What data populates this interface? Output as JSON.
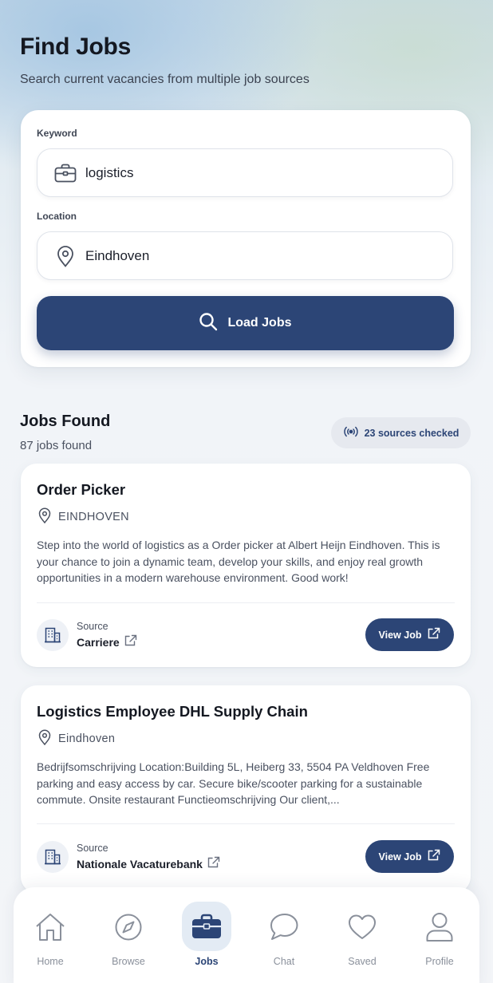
{
  "header": {
    "title": "Find Jobs",
    "subtitle": "Search current vacancies from multiple job sources"
  },
  "search": {
    "keyword_label": "Keyword",
    "keyword_value": "logistics",
    "location_label": "Location",
    "location_value": "Eindhoven",
    "load_button_label": "Load Jobs"
  },
  "results": {
    "heading": "Jobs Found",
    "count_text": "87 jobs found",
    "sources_badge": "23 sources checked"
  },
  "jobs": [
    {
      "title": "Order Picker",
      "location": "EINDHOVEN",
      "description": "Step into the world of logistics as a Order picker at Albert Heijn Eindhoven. This is your chance to join a dynamic team, develop your skills, and enjoy real growth opportunities in a modern warehouse environment. Good work!",
      "source_label": "Source",
      "source_name": "Carriere",
      "view_label": "View Job"
    },
    {
      "title": "Logistics Employee DHL Supply Chain",
      "location": "Eindhoven",
      "description": "Bedrijfsomschrijving Location:Building 5L, Heiberg 33, 5504 PA Veldhoven Free parking and easy access by car. Secure bike/scooter parking for a sustainable commute. Onsite restaurant  Functieomschrijving Our client,...",
      "source_label": "Source",
      "source_name": "Nationale Vacaturebank",
      "view_label": "View Job"
    }
  ],
  "tabbar": {
    "items": [
      {
        "label": "Home",
        "icon": "home-icon"
      },
      {
        "label": "Browse",
        "icon": "compass-icon"
      },
      {
        "label": "Jobs",
        "icon": "briefcase-icon",
        "active": true
      },
      {
        "label": "Chat",
        "icon": "chat-icon"
      },
      {
        "label": "Saved",
        "icon": "heart-icon"
      },
      {
        "label": "Profile",
        "icon": "user-icon"
      }
    ]
  },
  "colors": {
    "primary": "#2c4576",
    "active_tab_bg": "#e3ebf4",
    "inactive_tab": "#8a909b"
  }
}
